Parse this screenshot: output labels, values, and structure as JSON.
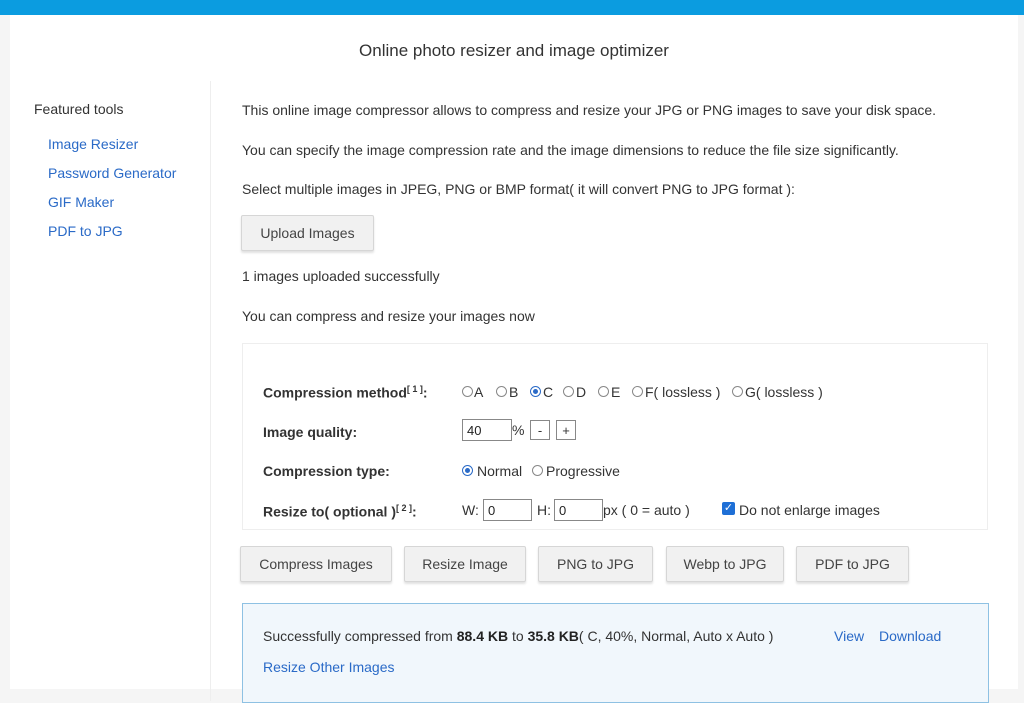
{
  "header": {
    "title": "Online photo resizer and image optimizer",
    "accent": "#0b9ce0"
  },
  "sidebar": {
    "heading": "Featured tools",
    "items": [
      {
        "label": "Image Resizer"
      },
      {
        "label": "Password Generator"
      },
      {
        "label": "GIF Maker"
      },
      {
        "label": "PDF to JPG"
      }
    ]
  },
  "intro": {
    "line1": "This online image compressor allows to compress and resize your JPG or PNG images to save your disk space.",
    "line2": "You can specify the image compression rate and the image dimensions to reduce the file size significantly.",
    "line3": "Select multiple images in JPEG, PNG or BMP format( it will convert PNG to JPG format ):"
  },
  "upload": {
    "button": "Upload Images",
    "status": "1 images uploaded successfully",
    "hint": "You can compress and resize your images now"
  },
  "options": {
    "method_label": "Compression method",
    "method_note": "[ 1 ]",
    "method_colon": ":",
    "methods": [
      "A",
      "B",
      "C",
      "D",
      "E",
      "F( lossless )",
      "G( lossless )"
    ],
    "method_selected": "C",
    "quality_label": "Image quality:",
    "quality_value": "40",
    "quality_unit": "%",
    "minus": "-",
    "plus": "+",
    "type_label": "Compression type:",
    "types": [
      "Normal",
      "Progressive"
    ],
    "type_selected": "Normal",
    "resize_label": "Resize to( optional )",
    "resize_note": "[ 2 ]",
    "resize_colon": ":",
    "w_label": "W:",
    "w_value": "0",
    "h_label": "H:",
    "h_value": "0",
    "px_hint": "px ( 0 = auto )",
    "no_enlarge_label": "Do not enlarge images",
    "no_enlarge_checked": true
  },
  "actions": {
    "compress": "Compress Images",
    "resize": "Resize Image",
    "png_to_jpg": "PNG to JPG",
    "webp_to_jpg": "Webp to JPG",
    "pdf_to_jpg": "PDF to JPG"
  },
  "result": {
    "prefix": "Successfully compressed from ",
    "from_size": "88.4 KB",
    "to_word": " to ",
    "to_size": "35.8 KB",
    "details": "( C, 40%, Normal, Auto x Auto )",
    "view": "View",
    "download": "Download",
    "resize_other": "Resize Other Images"
  }
}
